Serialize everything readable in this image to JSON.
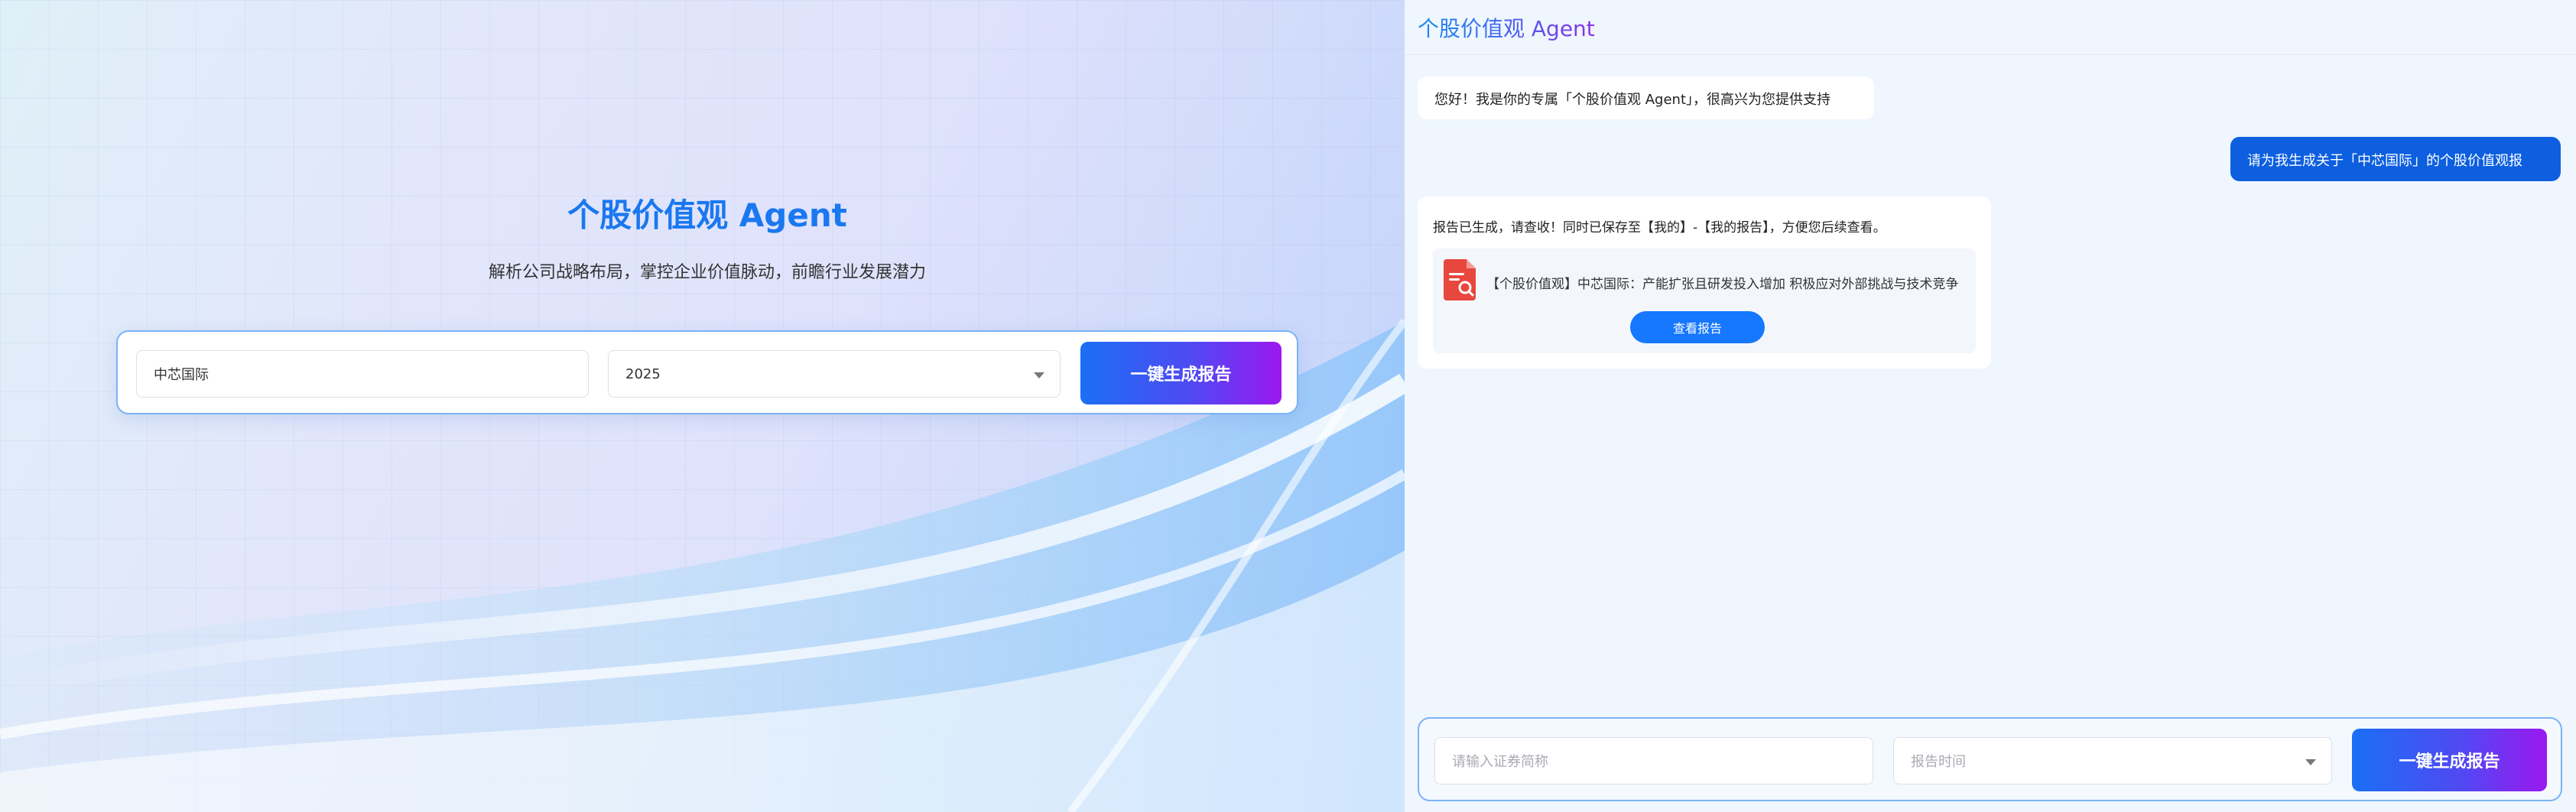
{
  "hero": {
    "title": "个股价值观 Agent",
    "subtitle": "解析公司战略布局，掌控企业价值脉动，前瞻行业发展潜力",
    "stock_value": "中芯国际",
    "year_value": "2025",
    "generate_label": "一键生成报告"
  },
  "chat": {
    "title": "个股价值观 Agent",
    "greeting": "您好！我是你的专属「个股价值观 Agent」，很高兴为您提供支持",
    "user_message": "请为我生成关于「中芯国际」的个股价值观报",
    "bot_message": "报告已生成，请查收！同时已保存至【我的】-【我的报告】，方便您后续查看。",
    "report_title": "【个股价值观】中芯国际：产能扩张且研发投入增加 积极应对外部挑战与技术竞争",
    "view_report_label": "查看报告",
    "stock_placeholder": "请输入证券简称",
    "time_placeholder": "报告时间",
    "generate_label": "一键生成报告"
  },
  "icons": {
    "report": "pdf-document-search-icon",
    "dropdown": "chevron-down-icon"
  },
  "colors": {
    "primary": "#1677ff",
    "user_bubble": "#0d5fe0",
    "button_gradient_start": "#1a6ff5",
    "button_gradient_end": "#9b18ef",
    "doc_icon": "#e8473d"
  }
}
